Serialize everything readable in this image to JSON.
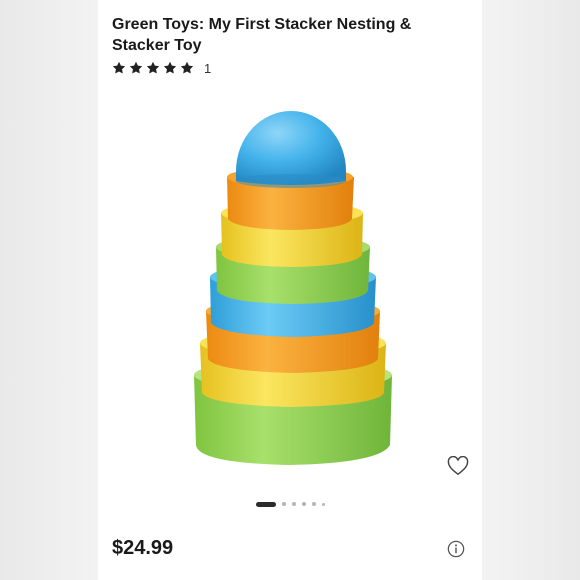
{
  "product": {
    "title": "Green Toys: My First Stacker Nesting & Stacker Toy",
    "rating": {
      "stars": 5,
      "count": "1"
    },
    "price": "$24.99",
    "image": {
      "icon": "stacking-cups-toy-image",
      "colors": [
        "#3fb1ec",
        "#f6a01f",
        "#f4d63a",
        "#93d552"
      ]
    }
  },
  "carousel": {
    "total": 6,
    "active_index": 0
  },
  "icons": {
    "favorite": "heart-outline-icon",
    "info": "info-circle-icon",
    "star": "star-icon"
  },
  "colors": {
    "text": "#1a1a1a",
    "background": "#ffffff",
    "dot_active": "#2b2b2b",
    "dot_inactive": "#b5b5b5"
  }
}
